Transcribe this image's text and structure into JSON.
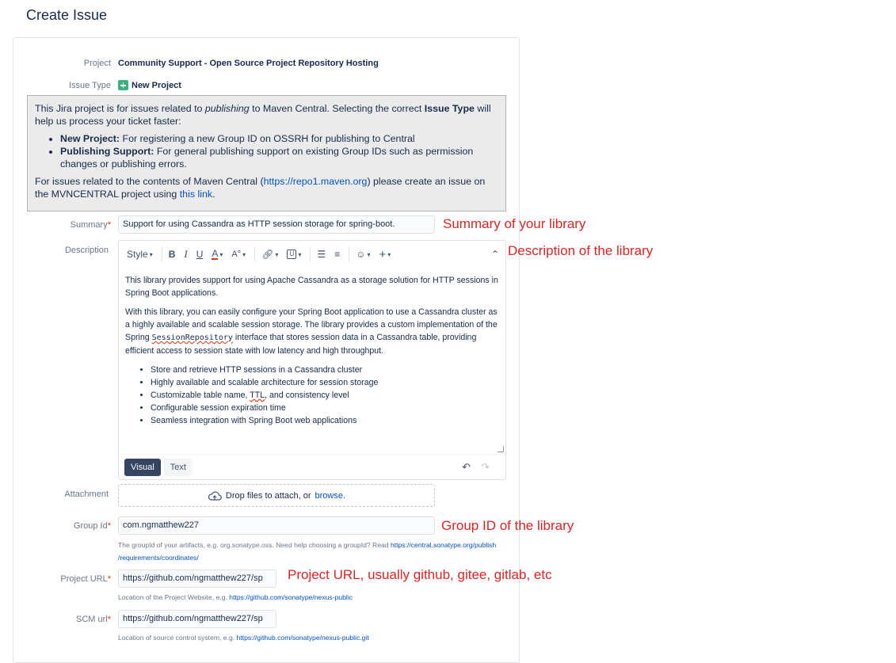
{
  "page": {
    "title": "Create Issue"
  },
  "fields": {
    "project": {
      "label": "Project",
      "value": "Community Support - Open Source Project Repository Hosting"
    },
    "issue_type": {
      "label": "Issue Type",
      "value": "New Project",
      "icon": "add-square-icon"
    },
    "summary": {
      "label": "Summary",
      "value": "Support for using Cassandra as HTTP session storage for spring-boot.",
      "annotation": "Summary of your library"
    },
    "description": {
      "label": "Description",
      "annotation": "Description of the library"
    },
    "attachment": {
      "label": "Attachment",
      "drop_text": "Drop files to attach, or",
      "browse": "browse."
    },
    "group_id": {
      "label": "Group Id",
      "value": "com.ngmatthew227",
      "annotation": "Group ID of the library",
      "help_text": "The groupId of your artifacts, e.g. org.sonatype.oss. Need help choosing a groupId? Read",
      "help_link_1": "https://central.sonatype.org/publish",
      "help_link_2": "/requirements/coordinates/"
    },
    "project_url": {
      "label": "Project URL",
      "value": "https://github.com/ngmatthew227/sp",
      "annotation": "Project URL, usually github, gitee, gitlab, etc",
      "help_text": "Location of the Project Website, e.g.",
      "help_link": "https://github.com/sonatype/nexus-public"
    },
    "scm_url": {
      "label": "SCM url",
      "value": "https://github.com/ngmatthew227/sp",
      "help_text": "Location of source control system, e.g.",
      "help_link": "https://github.com/sonatype/nexus-public.git"
    },
    "required_marker": "*"
  },
  "info": {
    "intro_1": "This Jira project is for issues related to",
    "intro_em": "publishing",
    "intro_2": "to Maven Central. Selecting the correct",
    "intro_strong": "Issue Type",
    "intro_3": "will help us process your ticket faster:",
    "items": [
      {
        "title": "New Project:",
        "text": "For registering a new Group ID on OSSRH for publishing to Central"
      },
      {
        "title": "Publishing Support:",
        "text": "For general publishing support on existing Group IDs such as permission changes or publishing errors."
      }
    ],
    "footer_1": "For issues related to the contents of Maven Central (",
    "footer_link": "https://repo1.maven.org",
    "footer_2": ") please create an issue on the MVNCENTRAL project using",
    "footer_link_2": "this link",
    "footer_3": "."
  },
  "editor": {
    "toolbar": {
      "style_label": "Style",
      "icons": [
        "bold-icon",
        "italic-icon",
        "underline-icon",
        "text-color-icon",
        "formatting-icon",
        "link-icon",
        "attachment-icon",
        "bullet-list-icon",
        "numbered-list-icon",
        "emoji-icon",
        "insert-icon",
        "collapse-icon"
      ]
    },
    "para_1": "This library provides support for using Apache Cassandra as a storage solution for HTTP sessions in Spring Boot applications.",
    "para_2a": "With this library, you can easily configure your Spring Boot application to use a Cassandra cluster as a highly available and scalable session storage. The library provides a custom implementation of the Spring",
    "para_2_code": "SessionRepository",
    "para_2b": "interface that stores session data in a Cassandra table, providing efficient access to session state with low latency and high throughput.",
    "bullets": [
      "Store and retrieve HTTP sessions in a Cassandra cluster",
      "Highly available and scalable architecture for session storage",
      "Configurable session expiration time",
      "Seamless integration with Spring Boot web applications"
    ],
    "bullet_3a": "Customizable table name,",
    "bullet_3_ttl": "TTL",
    "bullet_3b": ", and consistency level",
    "mode_visual": "Visual",
    "mode_text": "Text"
  }
}
